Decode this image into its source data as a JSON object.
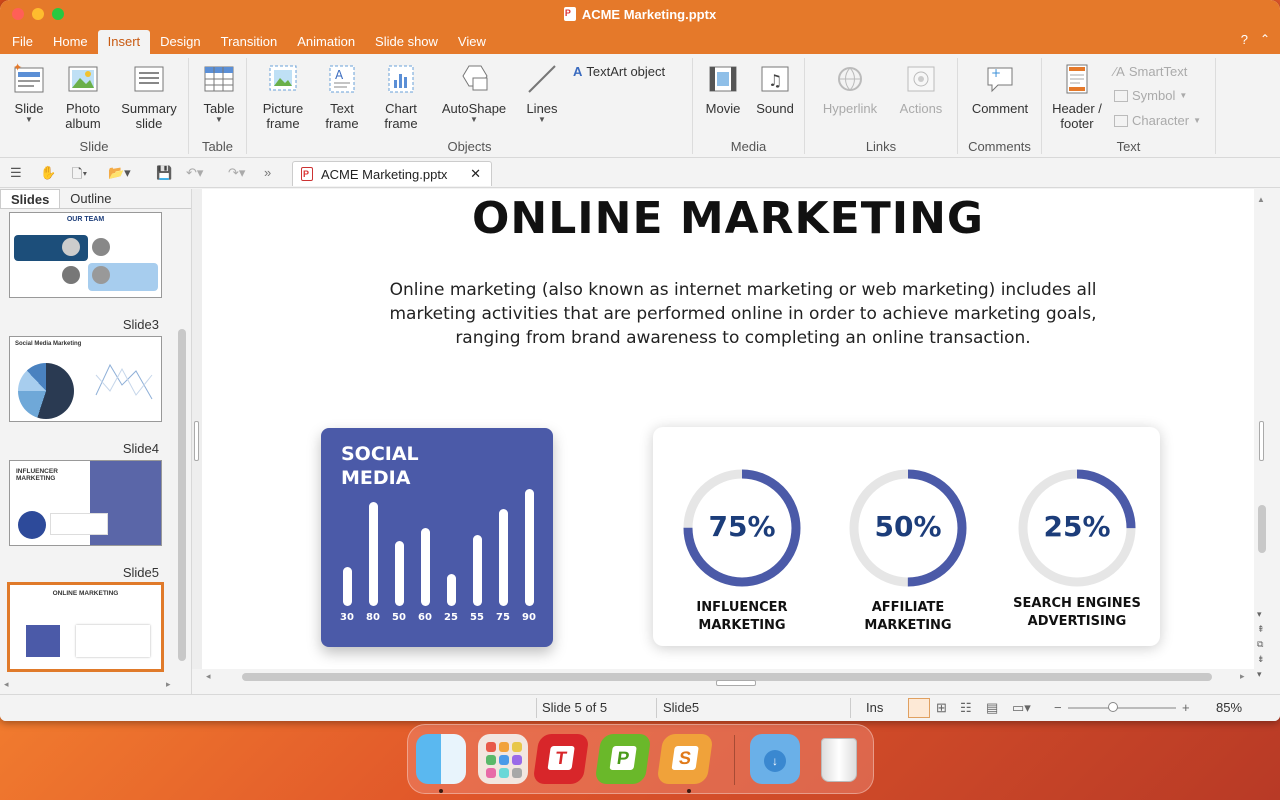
{
  "window": {
    "title": "ACME Marketing.pptx"
  },
  "menu": [
    "File",
    "Home",
    "Insert",
    "Design",
    "Transition",
    "Animation",
    "Slide show",
    "View"
  ],
  "menu_active": "Insert",
  "help": "?",
  "ribbon": {
    "slide": {
      "slide": "Slide",
      "photo_album": "Photo album",
      "summary_slide": "Summary slide",
      "group": "Slide"
    },
    "table": {
      "table": "Table",
      "group": "Table"
    },
    "objects": {
      "picture_frame": "Picture frame",
      "text_frame": "Text frame",
      "chart_frame": "Chart frame",
      "autoshape": "AutoShape",
      "lines": "Lines",
      "textart": "TextArt object",
      "group": "Objects"
    },
    "media": {
      "movie": "Movie",
      "sound": "Sound",
      "group": "Media"
    },
    "links": {
      "hyperlink": "Hyperlink",
      "actions": "Actions",
      "group": "Links"
    },
    "comments": {
      "comment": "Comment",
      "group": "Comments"
    },
    "text": {
      "header_footer": "Header / footer",
      "smarttext": "SmartText",
      "symbol": "Symbol",
      "character": "Character",
      "group": "Text"
    }
  },
  "doc_tab": "ACME Marketing.pptx",
  "sidebar": {
    "tabs": [
      "Slides",
      "Outline"
    ],
    "slides": [
      {
        "label": "",
        "title": "OUR TEAM"
      },
      {
        "label": "Slide3",
        "title": "Social Media Marketing"
      },
      {
        "label": "Slide4",
        "title": "INFLUENCER MARKETING"
      },
      {
        "label": "Slide5",
        "title": "ONLINE MARKETING"
      }
    ]
  },
  "slide": {
    "title": "ONLINE MARKETING",
    "body": "Online marketing (also known as internet marketing or web marketing) includes all marketing activities that are performed online in order to achieve marketing goals, ranging from brand awareness to completing an online transaction.",
    "social_card_title": "SOCIAL MEDIA",
    "chart_data": {
      "type": "bar",
      "categories": [
        "30",
        "80",
        "50",
        "60",
        "25",
        "55",
        "75",
        "90"
      ],
      "values": [
        30,
        80,
        50,
        60,
        25,
        55,
        75,
        90
      ]
    },
    "stats": [
      {
        "value": "75%",
        "pct": 75,
        "label": "INFLUENCER MARKETING"
      },
      {
        "value": "50%",
        "pct": 50,
        "label": "AFFILIATE MARKETING"
      },
      {
        "value": "25%",
        "pct": 25,
        "label": "SEARCH ENGINES ADVERTISING"
      }
    ],
    "colors": {
      "accent": "#4b5aa8",
      "title": "#111111"
    }
  },
  "status": {
    "slide_pos": "Slide 5 of 5",
    "slide_name": "Slide5",
    "mode": "Ins",
    "zoom": "85%"
  },
  "dock": [
    "finder-icon",
    "launchpad-icon",
    "textmaker-icon",
    "planmaker-icon",
    "presentations-icon",
    "downloads-icon",
    "trash-icon"
  ]
}
